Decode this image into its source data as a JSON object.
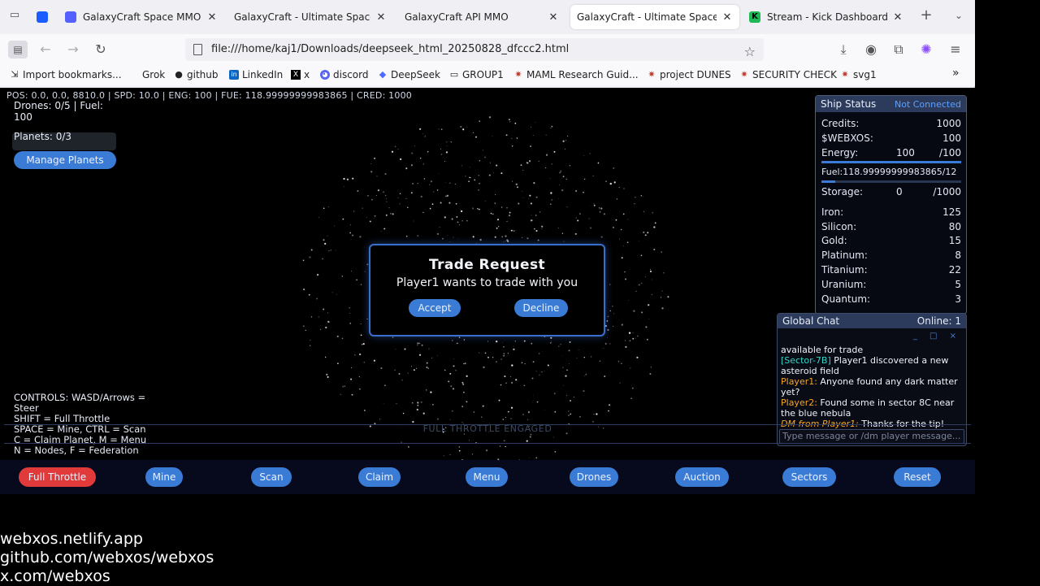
{
  "browser": {
    "tabs": [
      {
        "title": "GalaxyCraft Space MMO De",
        "favicon_color": "#5561ff",
        "active": false
      },
      {
        "title": "GalaxyCraft - Ultimate Space M",
        "favicon_color": "#ffffff",
        "active": false
      },
      {
        "title": "GalaxyCraft API MMO",
        "favicon_color": "#ffffff",
        "active": false
      },
      {
        "title": "GalaxyCraft - Ultimate Space M",
        "favicon_color": "#ffffff",
        "active": true
      },
      {
        "title": "Stream - Kick Dashboard",
        "favicon_color": "#1db954",
        "active": false
      }
    ],
    "new_tab": "+",
    "url": "file:///home/kaj1/Downloads/deepseek_html_20250828_dfccc2.html",
    "bookmarks": [
      {
        "label": "Import bookmarks...",
        "icon": "import-icon"
      },
      {
        "label": "Grok",
        "icon": ""
      },
      {
        "label": "github",
        "icon": "github-icon"
      },
      {
        "label": "LinkedIn",
        "icon": "linkedin-icon"
      },
      {
        "label": "x",
        "icon": "x-icon"
      },
      {
        "label": "discord",
        "icon": "discord-icon"
      },
      {
        "label": "DeepSeek",
        "icon": "deepseek-icon"
      },
      {
        "label": "GROUP1",
        "icon": "folder-icon"
      },
      {
        "label": "MAML Research Guid...",
        "icon": "globe-icon"
      },
      {
        "label": "project DUNES",
        "icon": "globe-icon"
      },
      {
        "label": "SECURITY CHECK",
        "icon": "globe-icon"
      },
      {
        "label": "svg1",
        "icon": "globe-icon"
      }
    ]
  },
  "hud": {
    "top_line": "POS: 0.0, 0.0, 8810.0 | SPD: 10.0 | ENG: 100 | FUE: 118.99999999983865 | CRED: 1000",
    "drones": "Drones: 0/5 | Fuel: 100",
    "planets": "Planets: 0/3",
    "manage_planets": "Manage Planets"
  },
  "status": {
    "title": "Ship Status",
    "connection": "Not Connected",
    "credits_label": "Credits:",
    "credits": "1000",
    "webxos_label": "$WEBXOS:",
    "webxos": "100",
    "energy_label": "Energy:",
    "energy": "100",
    "energy_max": "/100",
    "energy_fraction": 1.0,
    "fuel_label": "Fuel:",
    "fuel": "118.99999999983865/12",
    "fuel_fraction": 0.1,
    "storage_label": "Storage:",
    "storage": "0",
    "storage_max": "/1000",
    "resources": [
      {
        "name": "Iron:",
        "value": "125"
      },
      {
        "name": "Silicon:",
        "value": "80"
      },
      {
        "name": "Gold:",
        "value": "15"
      },
      {
        "name": "Platinum:",
        "value": "8"
      },
      {
        "name": "Titanium:",
        "value": "22"
      },
      {
        "name": "Uranium:",
        "value": "5"
      },
      {
        "name": "Quantum:",
        "value": "3"
      }
    ]
  },
  "chat": {
    "title": "Global Chat",
    "online": "Online: 1",
    "controls": "_ □ ×",
    "messages": [
      {
        "who": "",
        "text": "available for trade",
        "color": "#eef2fa"
      },
      {
        "who": "[Sector-7B]",
        "text": " Player1 discovered a new asteroid field",
        "color": "#33d6c8"
      },
      {
        "who": "Player1:",
        "text": " Anyone found any dark matter yet?",
        "color": "#f5a623"
      },
      {
        "who": "Player2:",
        "text": " Found some in sector 8C near the blue nebula",
        "color": "#f5a623"
      },
      {
        "who": "DM from Player1:",
        "text": " Thanks for the tip!",
        "color": "#f5a623"
      }
    ],
    "input_placeholder": "Type message or /dm player message..."
  },
  "trade": {
    "title": "Trade Request",
    "message": "Player1 wants to trade with you",
    "accept": "Accept",
    "decline": "Decline"
  },
  "controls_help": {
    "lines": [
      "CONTROLS: WASD/Arrows = Steer",
      "SHIFT = Full Throttle",
      "SPACE = Mine, CTRL = Scan",
      "C = Claim Planet, M = Menu",
      "N = Nodes, F = Federation"
    ]
  },
  "throttle_notice": "FULL THROTTLE ENGAGED",
  "actions": [
    {
      "label": "Full Throttle",
      "color": "#e03a3a"
    },
    {
      "label": "Mine",
      "color": "#3a7bd5"
    },
    {
      "label": "Scan",
      "color": "#3a7bd5"
    },
    {
      "label": "Claim",
      "color": "#3a7bd5"
    },
    {
      "label": "Menu",
      "color": "#3a7bd5"
    },
    {
      "label": "Drones",
      "color": "#3a7bd5"
    },
    {
      "label": "Auction",
      "color": "#3a7bd5"
    },
    {
      "label": "Sectors",
      "color": "#3a7bd5"
    },
    {
      "label": "Reset",
      "color": "#3a7bd5"
    }
  ],
  "footer": {
    "line1": "webxos.netlify.app",
    "line2": "github.com/webxos/webxos",
    "line3": "x.com/webxos"
  }
}
